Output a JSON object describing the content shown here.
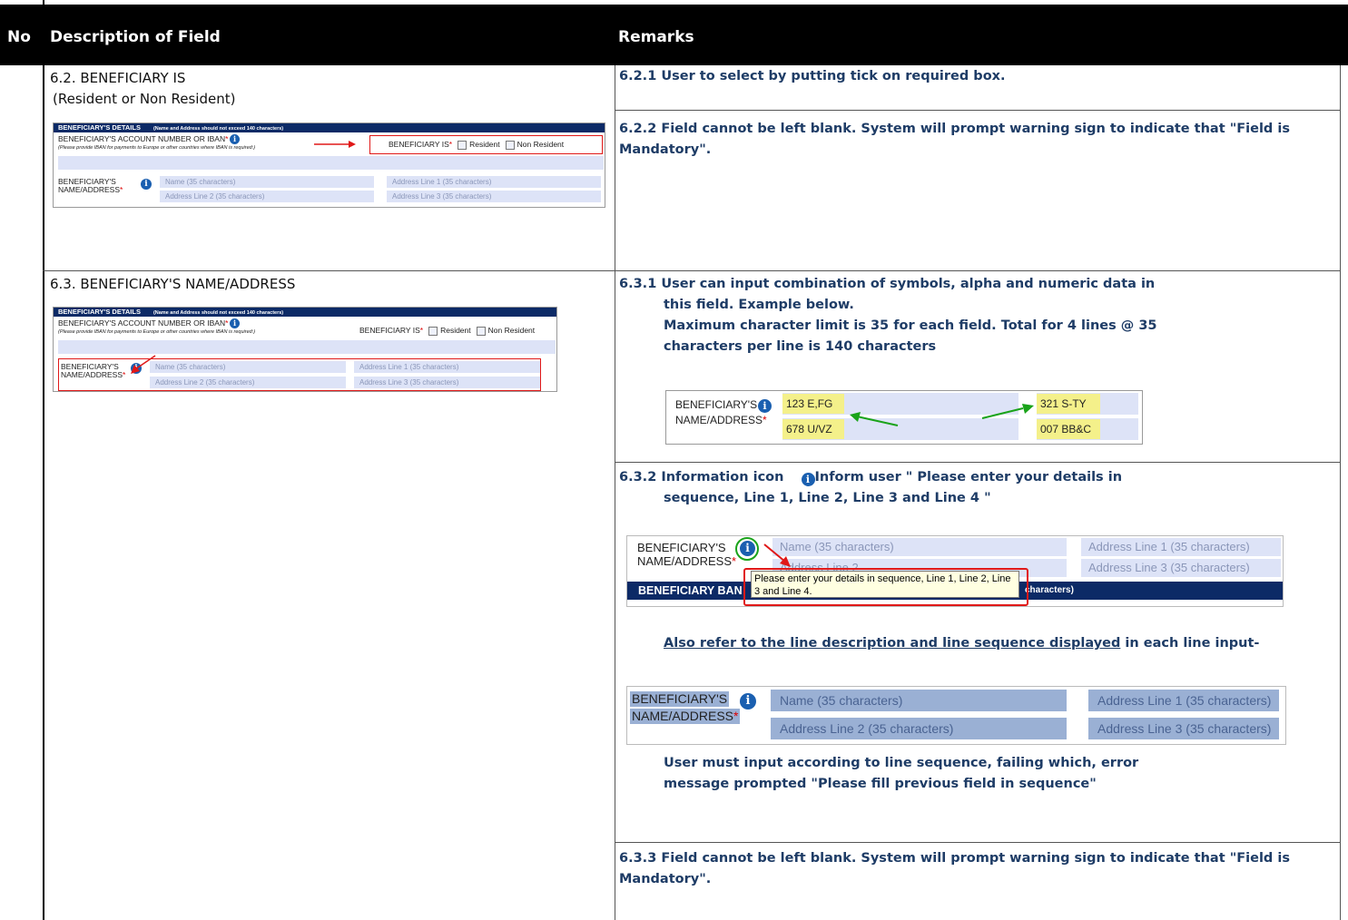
{
  "header": {
    "no": "No",
    "description": "Description of Field",
    "remarks": "Remarks"
  },
  "row_62": {
    "title": "6.2.  BENEFICIARY IS",
    "subtitle": "(Resident or Non Resident)",
    "remark_1": "6.2.1   User to select by putting tick on required box.",
    "remark_2": "6.2.2   Field cannot be left blank. System will prompt warning sign to indicate that \"Field is Mandatory\"."
  },
  "row_63": {
    "title": "6.3.  BENEFICIARY'S NAME/ADDRESS",
    "remark_1_line1": "6.3.1   User can input combination of symbols, alpha and numeric data in",
    "remark_1_line2": "this field. Example below.",
    "remark_1_line3": "Maximum character limit is 35 for each field. Total for 4 lines @ 35",
    "remark_1_line4": "characters per line is 140 characters",
    "remark_2_line1": "6.3.2   Information icon",
    "remark_2_line1b": "Inform user \" Please enter your details in",
    "remark_2_line2": "sequence, Line 1, Line 2, Line 3 and Line 4 \"",
    "also_refer_underlined": "Also refer to the line description and line sequence displayed",
    "also_refer_rest": " in each line input-",
    "sequence_note_line1": "User  must input according to line sequence, failing which, error",
    "sequence_note_line2": "message prompted \"Please fill previous field in sequence\"",
    "remark_3": "6.3.3   Field cannot be left blank. System will prompt warning sign to indicate that \"Field is Mandatory\"."
  },
  "mini_form": {
    "section_title": "BENEFICIARY'S DETAILS",
    "section_note": "(Name and Address should not exceed 140 characters)",
    "account_label": "BENEFICIARY'S ACCOUNT NUMBER OR IBAN",
    "account_hint": "(Please provide IBAN for payments to Europe or other countries where IBAN is required:)",
    "beneficiary_is_label": "BENEFICIARY IS",
    "resident": "Resident",
    "non_resident": "Non Resident",
    "name_label_1": "BENEFICIARY'S",
    "name_label_2": "NAME/ADDRESS",
    "required_mark": "*",
    "name_placeholder": "Name (35 characters)",
    "addr1_placeholder": "Address Line 1 (35 characters)",
    "addr2_placeholder": "Address Line 2 (35 characters)",
    "addr3_placeholder": "Address Line 3 (35 characters)"
  },
  "example_1": {
    "name": "123 E,FG",
    "addr1": "321 S-TY",
    "addr2": "678 U/VZ",
    "addr3": "007 BB&C"
  },
  "tooltip_example": {
    "name_label_1": "BENEFICIARY'S",
    "name_label_2": "NAME/ADDRESS",
    "name_placeholder": "Name (35 characters)",
    "addr1_placeholder": "Address Line 1 (35 characters)",
    "addr2_partial": "Address Line 2",
    "addr3_placeholder": "Address Line 3 (35 characters)",
    "tooltip": "Please enter your details in sequence, Line 1, Line 2, Line 3 and Line 4.",
    "bank_bar": "BENEFICIARY BAN",
    "bank_bar_tail": "characters)"
  },
  "colors": {
    "header_bg": "#000000",
    "remark_text": "#1e3c66",
    "form_bar": "#0c2a66",
    "field_bg": "#dde3f7",
    "highlight": "#f4f08a",
    "red": "#e01818",
    "green": "#1aa31a"
  }
}
